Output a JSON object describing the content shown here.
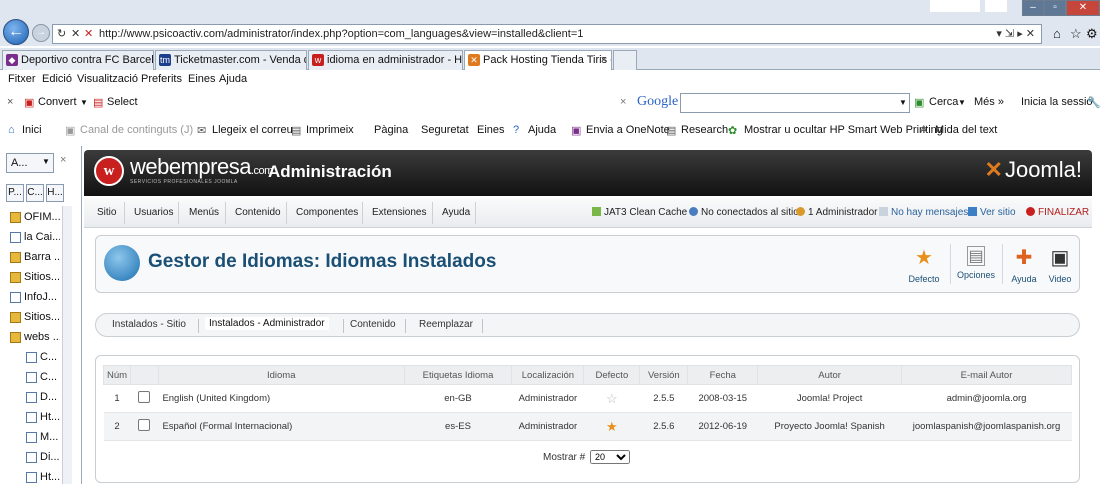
{
  "browser": {
    "url": "http://www.psicoactiv.com/administrator/index.php?option=com_languages&view=installed&client=1",
    "tabs": [
      {
        "label": "Deportivo contra FC Barcelona..."
      },
      {
        "label": "Ticketmaster.com - Venda d'e..."
      },
      {
        "label": "idioma en administrador - Hos..."
      },
      {
        "label": "Pack Hosting Tienda Tiris - ..."
      }
    ],
    "menu": [
      "Fitxer",
      "Edició",
      "Visualització",
      "Preferits",
      "Eines",
      "Ajuda"
    ],
    "gbar": {
      "convert": "Convert",
      "select": "Select",
      "google": "Google",
      "cerca": "Cerca",
      "mes": "Més »",
      "inicia": "Inicia la sessió"
    },
    "cmdbar": [
      "Inici",
      "Canal de continguts (J)",
      "Llegeix el correu",
      "Imprimeix",
      "Pàgina",
      "Seguretat",
      "Eines",
      "Ajuda",
      "Envia a OneNote",
      "Research",
      "Mostrar u ocultar HP Smart Web Printing",
      "Mida del text"
    ]
  },
  "sidebar": {
    "header": "A...",
    "tabs": [
      "P...",
      "C...",
      "H..."
    ],
    "items": [
      {
        "label": "OFIM...",
        "type": "folder"
      },
      {
        "label": "la Cai...",
        "type": "page"
      },
      {
        "label": "Barra ...",
        "type": "folder"
      },
      {
        "label": "Sitios...",
        "type": "folder"
      },
      {
        "label": "InfoJ...",
        "type": "page"
      },
      {
        "label": "Sitios...",
        "type": "folder"
      },
      {
        "label": "webs ...",
        "type": "folder"
      },
      {
        "label": "C...",
        "type": "page"
      },
      {
        "label": "C...",
        "type": "page"
      },
      {
        "label": "D...",
        "type": "page"
      },
      {
        "label": "Ht...",
        "type": "page"
      },
      {
        "label": "M...",
        "type": "page"
      },
      {
        "label": "Di...",
        "type": "page"
      },
      {
        "label": "Ht...",
        "type": "page"
      }
    ]
  },
  "joomla": {
    "brand": "webempresa",
    "brand_suffix": ".com",
    "brand_sub": "SERVICIOS PROFESIONALES JOOMLA",
    "admin_title": "Administración",
    "joomla_logo": "Joomla!",
    "menu": [
      "Sitio",
      "Usuarios",
      "Menús",
      "Contenido",
      "Componentes",
      "Extensiones",
      "Ayuda"
    ],
    "status": {
      "cache": "JAT3 Clean Cache",
      "online": "No conectados al sitio",
      "admins": "1 Administrador",
      "messages": "No hay mensajes",
      "view_site": "Ver sitio",
      "logout": "FINALIZAR"
    },
    "page_title": "Gestor de Idiomas: Idiomas Instalados",
    "toolbar": {
      "default": "Defecto",
      "options": "Opciones",
      "help": "Ayuda",
      "video": "Video"
    },
    "subtabs": [
      "Instalados - Sitio",
      "Instalados - Administrador",
      "Contenido",
      "Reemplazar"
    ],
    "table": {
      "headers": [
        "Núm",
        "",
        "Idioma",
        "Etiquetas Idioma",
        "Localización",
        "Defecto",
        "Versión",
        "Fecha",
        "Autor",
        "E-mail Autor"
      ],
      "rows": [
        {
          "num": "1",
          "idioma": "English (United Kingdom)",
          "tag": "en-GB",
          "loc": "Administrador",
          "default": false,
          "version": "2.5.5",
          "date": "2008-03-15",
          "author": "Joomla! Project",
          "email": "admin@joomla.org"
        },
        {
          "num": "2",
          "idioma": "Español (Formal Internacional)",
          "tag": "es-ES",
          "loc": "Administrador",
          "default": true,
          "version": "2.5.6",
          "date": "2012-06-19",
          "author": "Proyecto Joomla! Spanish",
          "email": "joomlaspanish@joomlaspanish.org"
        }
      ]
    },
    "pager": {
      "label": "Mostrar #",
      "value": "20"
    }
  }
}
